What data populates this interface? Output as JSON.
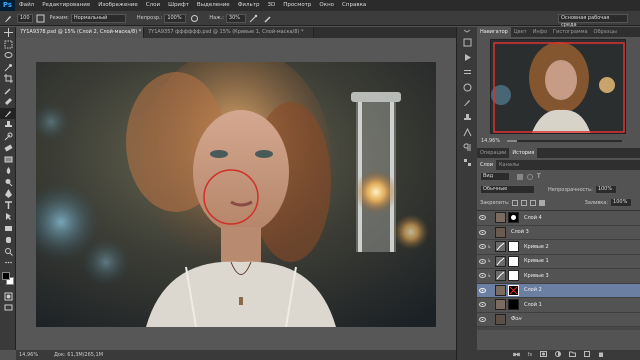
{
  "app": {
    "logo": "Ps"
  },
  "menu": [
    "Файл",
    "Редактирование",
    "Изображение",
    "Слои",
    "Шрифт",
    "Выделение",
    "Фильтр",
    "3D",
    "Просмотр",
    "Окно",
    "Справка"
  ],
  "options": {
    "brush_size": "100",
    "mode_label": "Режим:",
    "mode_value": "Нормальный",
    "opacity_label": "Непрозр.:",
    "opacity_value": "100%",
    "pressure_label": "Наж.:",
    "pressure_value": "30%",
    "workspace": "Основная рабочая среда"
  },
  "tabs": [
    {
      "label": "7Y1A9378.psd @ 15% (Слой 2, Слой-маска/8) *",
      "active": true
    },
    {
      "label": "7Y1A9357 фффффф.psd @ 15% (Кривые 1, Слой-маска/8) *",
      "active": false
    }
  ],
  "status": {
    "zoom": "14,96%",
    "doc": "Док: 61,3M/265,1M"
  },
  "navigator": {
    "tabs": [
      "Навигатор",
      "Цвет",
      "Инфо",
      "Гистограмма",
      "Образцы"
    ],
    "zoom": "14,96%"
  },
  "history_tabs": [
    "Операции",
    "История"
  ],
  "layers": {
    "tabs": [
      "Слои",
      "Каналы"
    ],
    "kind": "Вид",
    "blend_mode": "Обычные",
    "opacity_label": "Непрозрачность:",
    "opacity_value": "100%",
    "lock_label": "Закрепить:",
    "fill_label": "Заливка:",
    "fill_value": "100%",
    "items": [
      {
        "name": "Слой 4",
        "type": "pixel-mask"
      },
      {
        "name": "Слой 3",
        "type": "pixel"
      },
      {
        "name": "Кривые 2",
        "type": "adjustment"
      },
      {
        "name": "Кривые 1",
        "type": "adjustment"
      },
      {
        "name": "Кривые 3",
        "type": "adjustment"
      },
      {
        "name": "Слой 2",
        "type": "pixel-mask",
        "selected": true
      },
      {
        "name": "Слой 1",
        "type": "pixel-mask"
      },
      {
        "name": "Фон",
        "type": "background"
      }
    ]
  },
  "colors": {
    "accent": "#6b7fa3",
    "circle": "#d0302a",
    "chrome": "#3a3a3a"
  }
}
